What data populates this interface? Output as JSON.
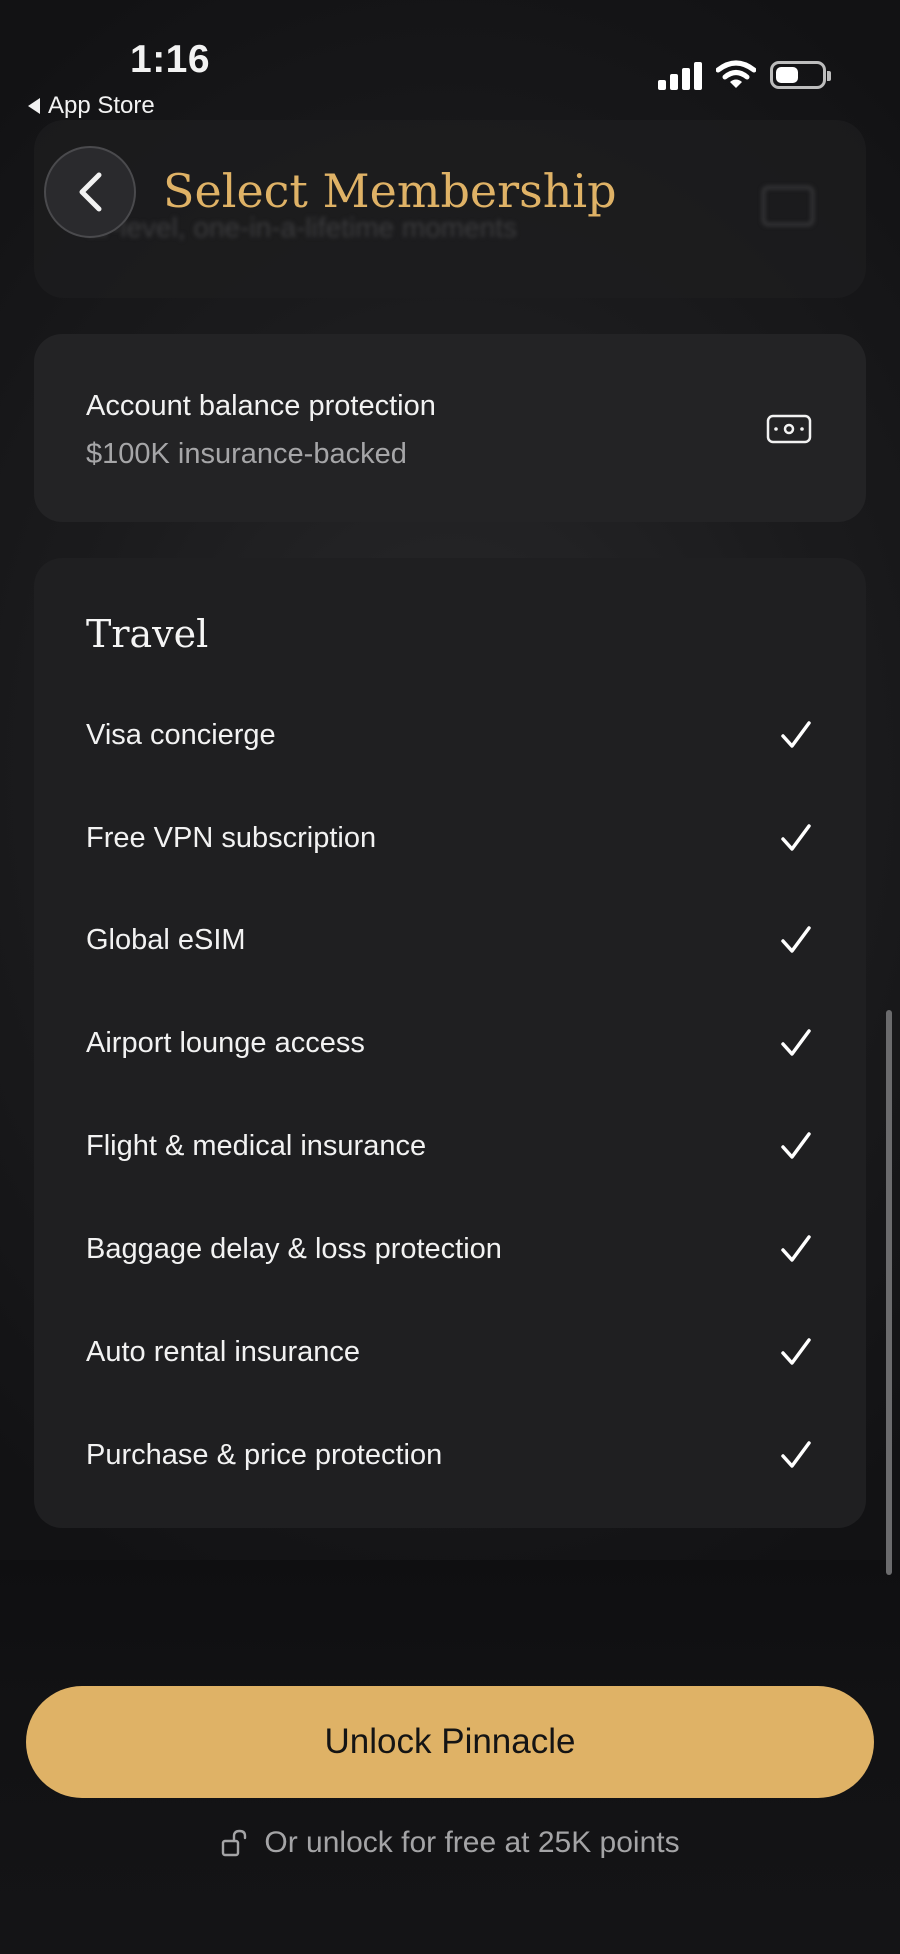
{
  "status_bar": {
    "time": "1:16",
    "back_app": "App Store"
  },
  "header": {
    "title": "Select Membership",
    "ghost_subtitle": "ar-level, one-in-a-lifetime moments"
  },
  "protection_card": {
    "title": "Account balance protection",
    "subtitle": "$100K insurance-backed",
    "icon": "cash-icon"
  },
  "travel_card": {
    "title": "Travel",
    "features": [
      {
        "label": "Visa concierge",
        "icon": "check-icon"
      },
      {
        "label": "Free VPN subscription",
        "icon": "check-icon"
      },
      {
        "label": "Global eSIM",
        "icon": "check-icon"
      },
      {
        "label": "Airport lounge access",
        "icon": "check-icon"
      },
      {
        "label": "Flight & medical insurance",
        "icon": "check-icon"
      },
      {
        "label": "Baggage delay & loss protection",
        "icon": "check-icon"
      },
      {
        "label": "Auto rental insurance",
        "icon": "check-icon"
      },
      {
        "label": "Purchase & price protection",
        "icon": "check-icon"
      }
    ]
  },
  "footer": {
    "cta_label": "Unlock Pinnacle",
    "free_unlock_text": "Or unlock for free at 25K points"
  },
  "colors": {
    "accent": "#dfb266",
    "background": "#141416",
    "card": "#1f1f21"
  }
}
